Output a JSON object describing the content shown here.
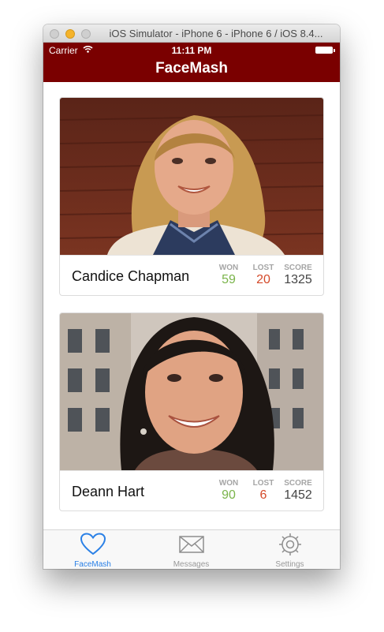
{
  "window": {
    "title": "iOS Simulator - iPhone 6 - iPhone 6 / iOS 8.4..."
  },
  "status_bar": {
    "carrier": "Carrier",
    "time": "11:11 PM"
  },
  "nav": {
    "title": "FaceMash"
  },
  "cards": [
    {
      "name": "Candice Chapman",
      "won_label": "WON",
      "won": "59",
      "lost_label": "LOST",
      "lost": "20",
      "score_label": "SCORE",
      "score": "1325"
    },
    {
      "name": "Deann Hart",
      "won_label": "WON",
      "won": "90",
      "lost_label": "LOST",
      "lost": "6",
      "score_label": "SCORE",
      "score": "1452"
    }
  ],
  "tabs": [
    {
      "label": "FaceMash",
      "icon": "heart-icon",
      "active": true
    },
    {
      "label": "Messages",
      "icon": "envelope-icon",
      "active": false
    },
    {
      "label": "Settings",
      "icon": "gear-icon",
      "active": false
    }
  ],
  "colors": {
    "nav_background": "#7a0000",
    "tab_active": "#2a80e6",
    "won": "#7ab44a",
    "lost": "#d44a2a"
  }
}
